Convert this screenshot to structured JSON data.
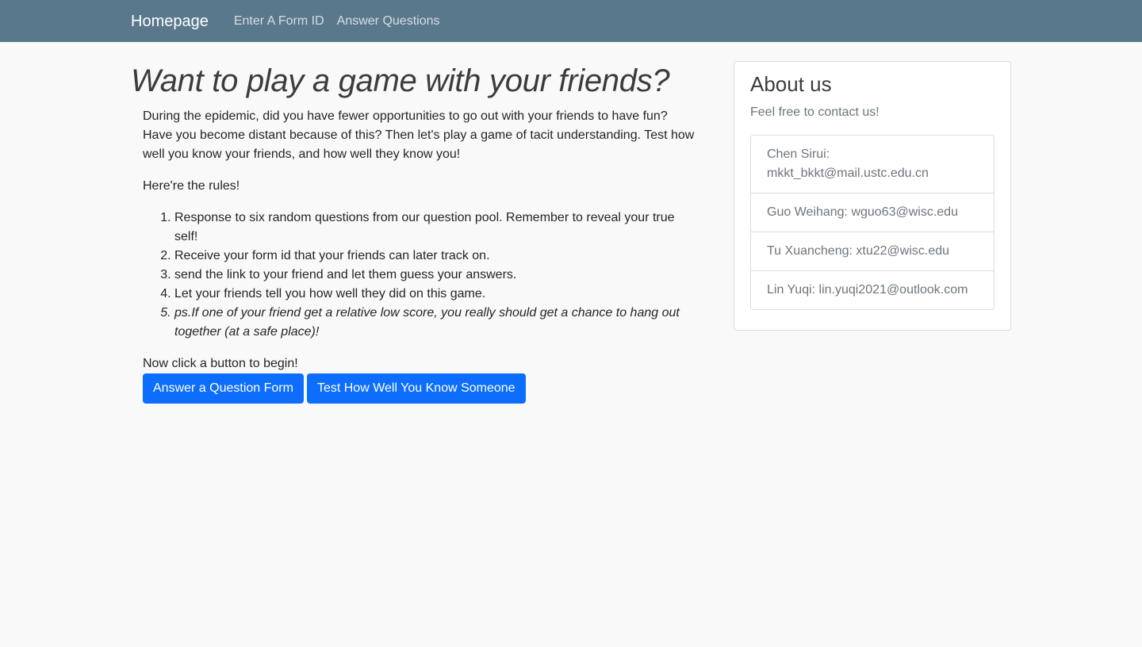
{
  "nav": {
    "brand": "Homepage",
    "links": [
      "Enter A Form ID",
      "Answer Questions"
    ]
  },
  "main": {
    "title": "Want to play a game with your friends?",
    "intro": "During the epidemic, did you have fewer opportunities to go out with your friends to have fun? Have you become distant because of this? Then let's play a game of tacit understanding. Test how well you know your friends, and how well they know you!",
    "rules_heading": "Here're the rules!",
    "rules": [
      "Response to six random questions from our question pool. Remember to reveal your true self!",
      "Receive your form id that your friends can later track on.",
      "send the link to your friend and let them guess your answers.",
      "Let your friends tell you how well they did on this game.",
      "ps.If one of your friend get a relative low score, you really should get a chance to hang out together (at a safe place)!"
    ],
    "begin_text": "Now click a button to begin!",
    "buttons": [
      "Answer a Question Form",
      "Test How Well You Know Someone"
    ]
  },
  "about": {
    "title": "About us",
    "subtitle": "Feel free to contact us!",
    "contacts": [
      "Chen Sirui: mkkt_bkkt@mail.ustc.edu.cn",
      "Guo Weihang: wguo63@wisc.edu",
      "Tu Xuancheng: xtu22@wisc.edu",
      "Lin Yuqi: lin.yuqi2021@outlook.com"
    ]
  },
  "colors": {
    "navbar": "#5a788c",
    "button": "#0d6efd",
    "background": "#f9f9f9"
  }
}
